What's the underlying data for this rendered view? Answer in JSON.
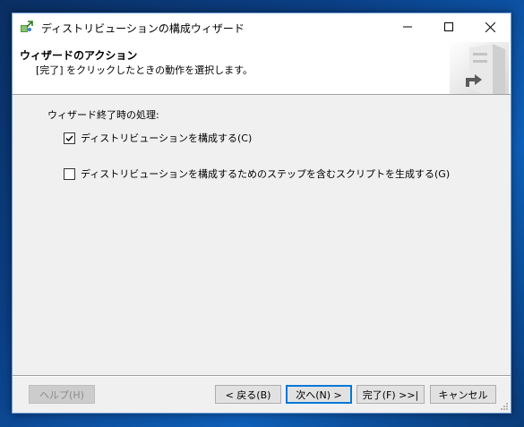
{
  "window": {
    "title": "ディストリビューションの構成ウィザード"
  },
  "header": {
    "title": "ウィザードのアクション",
    "subtitle": "[完了] をクリックしたときの動作を選択します。"
  },
  "content": {
    "section_label": "ウィザード終了時の処理:",
    "options": [
      {
        "label": "ディストリビューションを構成する(C)",
        "checked": true
      },
      {
        "label": "ディストリビューションを構成するためのステップを含むスクリプトを生成する(G)",
        "checked": false
      }
    ]
  },
  "buttons": {
    "help": "ヘルプ(H)",
    "back": "< 戻る(B)",
    "next": "次へ(N) >",
    "finish": "完了(F) >>|",
    "cancel": "キャンセル"
  },
  "icons": {
    "app": "wizard-app-icon",
    "minimize": "minimize-icon",
    "maximize": "maximize-icon",
    "close": "close-icon"
  },
  "colors": {
    "accent": "#0078d7",
    "window_bg": "#f0f0f0",
    "desktop": "#0b3f85"
  }
}
